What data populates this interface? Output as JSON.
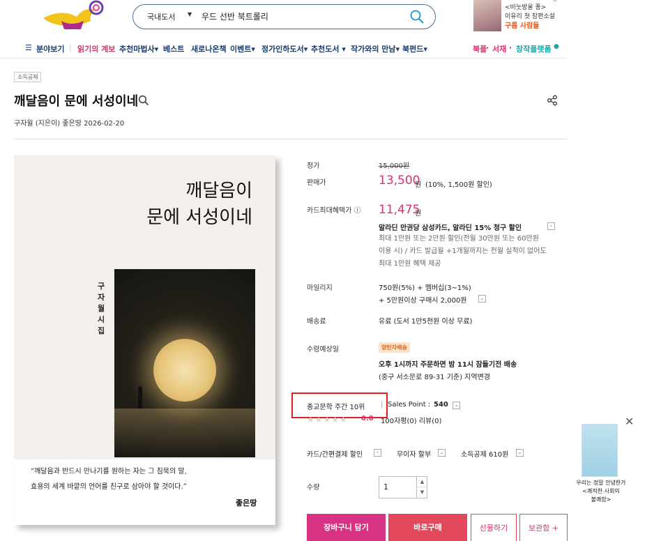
{
  "header": {
    "search_category": "국내도서",
    "search_query": "우드 선반 북트롤리",
    "ad_line1": "<비눗방울 퐁>",
    "ad_line2": "이유리 첫 장편소설",
    "ad_line3": "구름 사람들"
  },
  "nav": {
    "items": [
      "분야보기",
      "읽기의 계보",
      "추천마법사",
      "베스트",
      "새로나온책",
      "이벤트",
      "정가인하도서",
      "추천도서",
      "작가와의 만남",
      "북펀드"
    ],
    "right_1": "북플",
    "right_2": "서재",
    "right_3": "창작플랫폼"
  },
  "book": {
    "tag": "소득공제",
    "title": "깨달음이 문에 서성이네",
    "byline": "구자월 (지은이)   좋은땅   2026-02-20",
    "cover_title_line1": "깨달음이",
    "cover_title_line2": "문에 서성이네",
    "cover_vertical": "구자월 시집",
    "cover_quote1": "“깨달음과 반드시 만나기를 원하는 자는 그 침묵의 말,",
    "cover_quote2": "효용의 세계 바깥의 언어를 친구로 삼아야 할 것이다.”",
    "cover_publisher": "좋은땅"
  },
  "info": {
    "list_price_label": "정가",
    "list_price": "15,000원",
    "sale_label": "판매가",
    "sale_price": "13,500",
    "sale_unit": "원",
    "sale_note": "(10%, 1,500원 할인)",
    "card_label": "카드최대혜택가 ⓘ",
    "card_price": "11,475",
    "card_unit": "원",
    "card_promo": "알라딘 만권당 삼성카드, 알라딘 15% 청구 할인",
    "card_desc1": "최대 1만원 또는 2만원 할인(전월 30만원 또는 60만원",
    "card_desc2": "이용 시) / 카드 발급월 +1개월까지는 전월 실적이 없어도",
    "card_desc3": "최대 1만원 혜택 제공",
    "mileage_label": "마일리지",
    "mileage_1": "750원(5%) + 멤버십(3~1%)",
    "mileage_2": "+ 5만원이상 구매시 2,000원",
    "shipping_label": "배송료",
    "shipping": "유료 (도서 1만5천원 이상 무료)",
    "arrival_label": "수령예상일",
    "arrival_badge": "양탄자배송",
    "arrival_1": "오후 1시까지 주문하면 밤 11시 잠들기전 배송",
    "arrival_2": "(중구 서소문로 89-31 기준) 지역변경",
    "rank": "종교문학 주간 10위",
    "sales_point_label": "Sales Point : ",
    "sales_point": "540",
    "rating": "0.0",
    "review_counts": "100자평(0)   리뷰(0)",
    "pay_discount": "카드/간편결제 할인",
    "installment": "무이자 할부",
    "deduction": "소득공제 610원",
    "qty_label": "수량",
    "qty": "1"
  },
  "buttons": {
    "cart": "장바구니 담기",
    "buy": "바로구매",
    "gift": "선물하기",
    "keep": "보관함 +"
  },
  "float_ad": {
    "line1": "우리는 정말 안녕한가",
    "line2": "<쾌적한 사회의",
    "line3": "불쾌함>"
  }
}
